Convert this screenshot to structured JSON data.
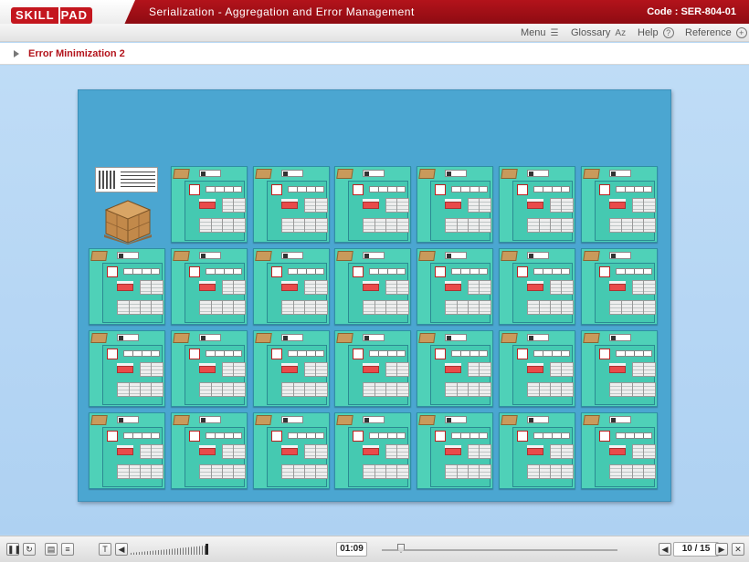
{
  "header": {
    "logo_left": "SKILL",
    "logo_right": "PAD",
    "title": "Serialization - Aggregation and Error Management",
    "code": "Code :  SER-804-01"
  },
  "menubar": {
    "menu_label": "Menu",
    "glossary_label": "Glossary",
    "glossary_icon_text": "Az",
    "help_label": "Help",
    "help_icon_text": "?",
    "reference_label": "Reference",
    "reference_icon_text": "+"
  },
  "breadcrumb": {
    "title": "Error Minimization 2"
  },
  "board": {
    "rows": 4,
    "columns": 7,
    "first_cell": "pallet"
  },
  "controls": {
    "pause_icon": "❚❚",
    "replay_icon": "↻",
    "notes_icon": "▤",
    "transcript_icon": "≡",
    "text_icon": "T",
    "volume_icon": "◀",
    "time": "01:09",
    "seek_progress": 0.08,
    "prev_icon": "◀",
    "page_current": "10",
    "page_total": "15",
    "page_text": "10 / 15",
    "next_icon": "▶",
    "close_icon": "✕"
  },
  "colors": {
    "brand_red": "#b3131b",
    "board_blue": "#4ba6d1",
    "case_teal": "#4fd1b8"
  }
}
